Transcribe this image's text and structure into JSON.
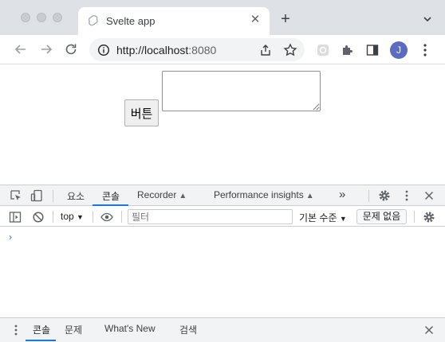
{
  "browser": {
    "tab_title": "Svelte app",
    "url_host": "http://localhost",
    "url_port": ":8080",
    "profile_initial": "J",
    "icons": {
      "favicon": "svelte-logo-icon",
      "close": "close-icon",
      "new_tab": "plus-icon",
      "tab_search": "chevron-down-icon",
      "back": "arrow-left-icon",
      "forward": "arrow-right-icon",
      "reload": "reload-icon",
      "info": "info-icon",
      "share": "share-icon",
      "bookmark": "star-icon",
      "extension_a": "extension-icon",
      "extensions": "puzzle-icon",
      "side_panel": "side-panel-icon",
      "menu": "kebab-menu-icon"
    }
  },
  "page": {
    "button_label": "버튼",
    "textarea_value": ""
  },
  "devtools": {
    "tabs": [
      {
        "label": "요소"
      },
      {
        "label": "콘솔"
      },
      {
        "label": "Recorder"
      },
      {
        "label": "Performance insights"
      }
    ],
    "active_tab": "콘솔",
    "context": "top",
    "filter_placeholder": "필터",
    "log_level": "기본 수준",
    "issues_label": "문제 없음",
    "prompt_glyph": "›",
    "drawer_tabs": [
      {
        "label": "콘솔"
      },
      {
        "label": "문제"
      },
      {
        "label": "What's New"
      },
      {
        "label": "검색"
      }
    ],
    "colors": {
      "accent": "#1a73e8",
      "avatar": "#5c6bc0"
    }
  }
}
